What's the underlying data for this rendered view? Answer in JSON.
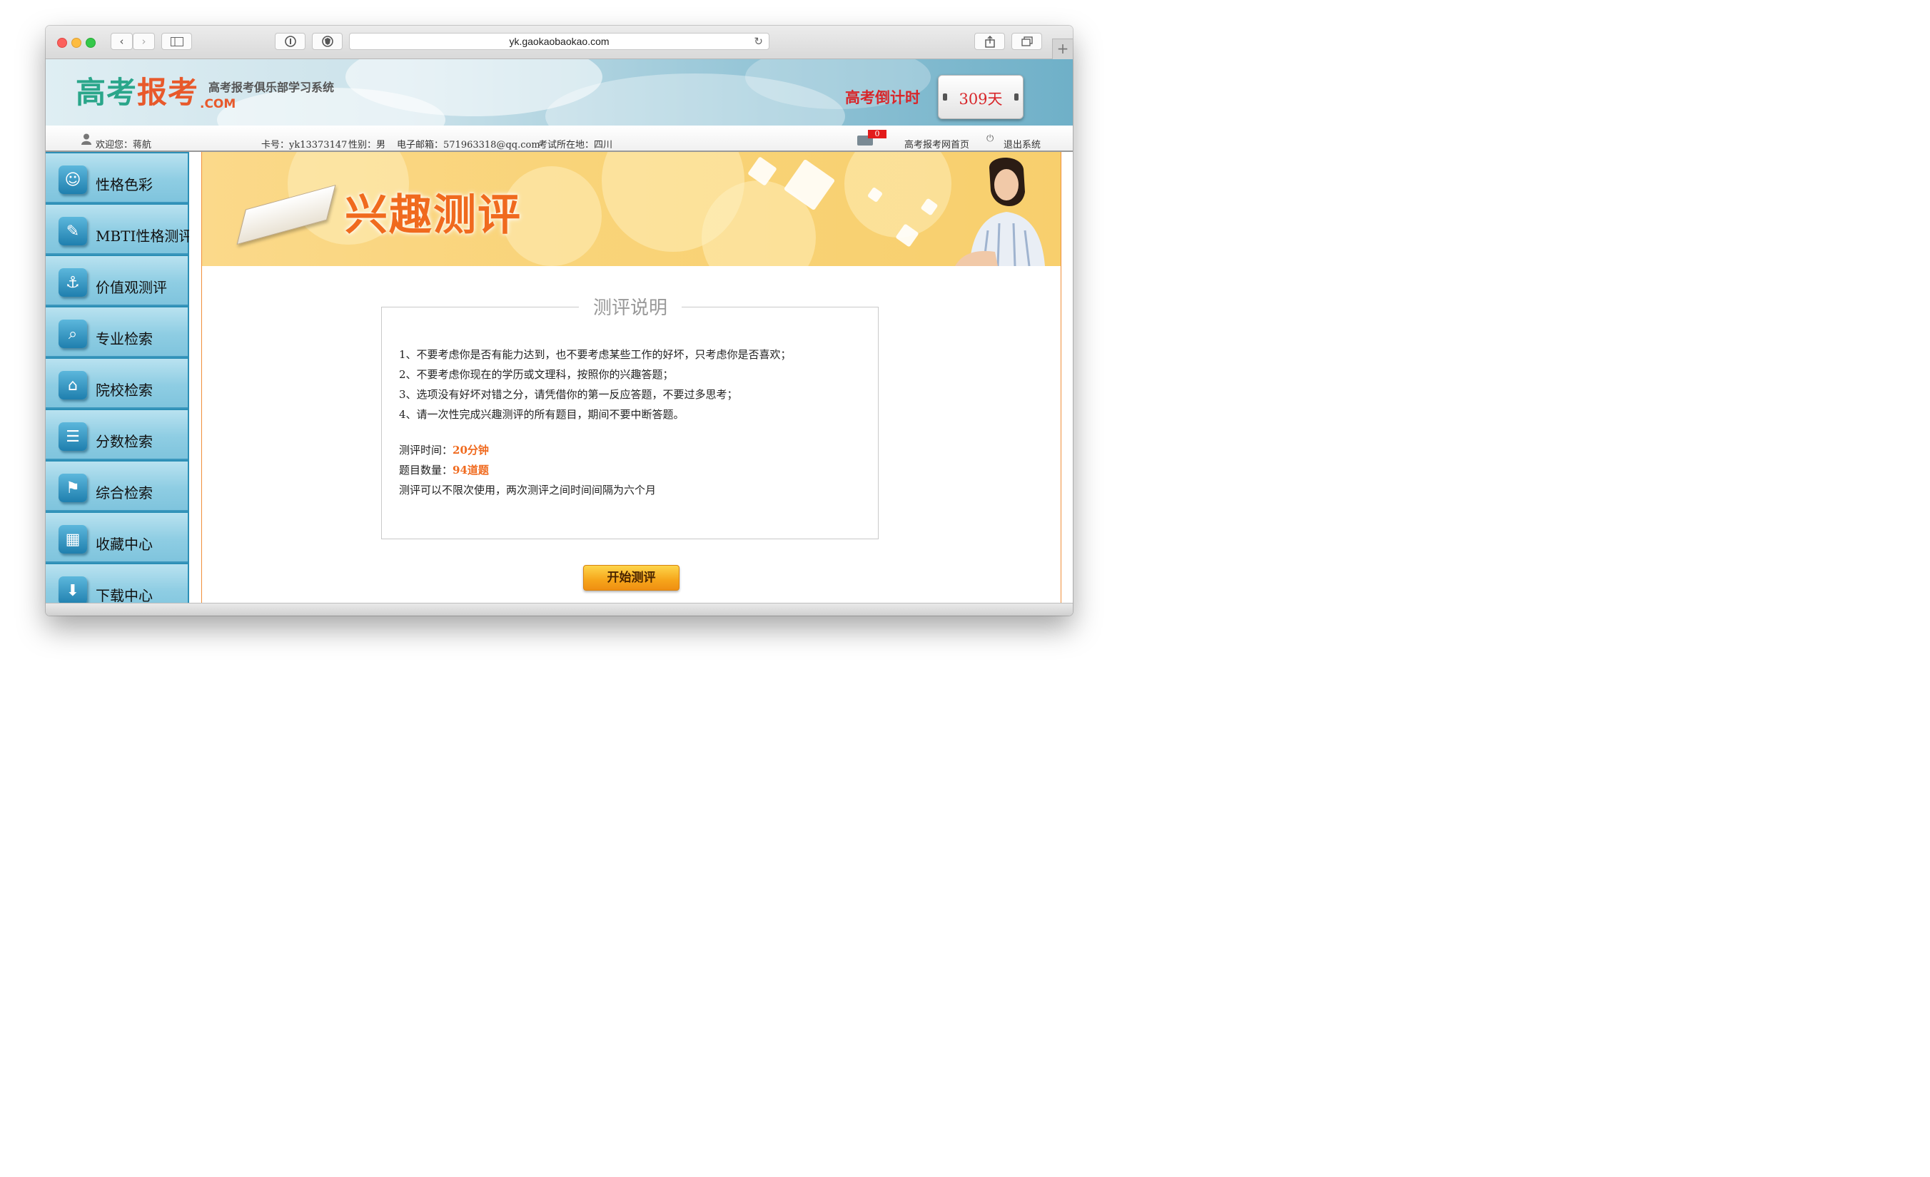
{
  "browser": {
    "url": "yk.gaokaobaokao.com",
    "back_glyph": "‹",
    "forward_glyph": "›",
    "reload_glyph": "↻",
    "new_tab_glyph": "+"
  },
  "header": {
    "logo_part1": "高考",
    "logo_part2": "报考",
    "logo_com": ".COM",
    "subtitle": "高考报考俱乐部学习系统",
    "countdown_label": "高考倒计时",
    "countdown_days": "309天"
  },
  "userbar": {
    "welcome": "欢迎您：蒋航",
    "card": "卡号：yk13373147",
    "gender": "性别：男",
    "email": "电子邮箱：571963318@qq.com",
    "location": "考试所在地：四川",
    "mail_count": "0",
    "home_link": "高考报考网首页",
    "logout_link": "退出系统"
  },
  "sidebar": {
    "items": [
      {
        "label": "性格色彩",
        "icon": "theater-mask-icon",
        "glyph": "☺"
      },
      {
        "label": "MBTI性格测评",
        "icon": "feather-icon",
        "glyph": "✎"
      },
      {
        "label": "价值观测评",
        "icon": "anchor-icon",
        "glyph": "⚓"
      },
      {
        "label": "专业检索",
        "icon": "magnifier-doc-icon",
        "glyph": "⌕"
      },
      {
        "label": "院校检索",
        "icon": "building-search-icon",
        "glyph": "⌂"
      },
      {
        "label": "分数检索",
        "icon": "list-icon",
        "glyph": "☰"
      },
      {
        "label": "综合检索",
        "icon": "signpost-icon",
        "glyph": "⚑"
      },
      {
        "label": "收藏中心",
        "icon": "collection-icon",
        "glyph": "▦"
      },
      {
        "label": "下载中心",
        "icon": "download-icon",
        "glyph": "⬇"
      }
    ]
  },
  "hero": {
    "title": "兴趣测评"
  },
  "notice": {
    "title": "测评说明",
    "rules": [
      "1、不要考虑你是否有能力达到，也不要考虑某些工作的好坏，只考虑你是否喜欢；",
      "2、不要考虑你现在的学历或文理科，按照你的兴趣答题；",
      "3、选项没有好坏对错之分，请凭借你的第一反应答题，不要过多思考；",
      "4、请一次性完成兴趣测评的所有题目，期间不要中断答题。"
    ],
    "time_label": "测评时间：",
    "time_value": "20分钟",
    "count_label": "题目数量：",
    "count_value": "94道题",
    "frequency_note": "测评可以不限次使用，两次测评之间时间间隔为六个月"
  },
  "actions": {
    "start_label": "开始测评"
  },
  "colors": {
    "accent_orange": "#f06a1e",
    "countdown_red": "#d8262a",
    "sidebar_blue": "#2c8fb6"
  }
}
